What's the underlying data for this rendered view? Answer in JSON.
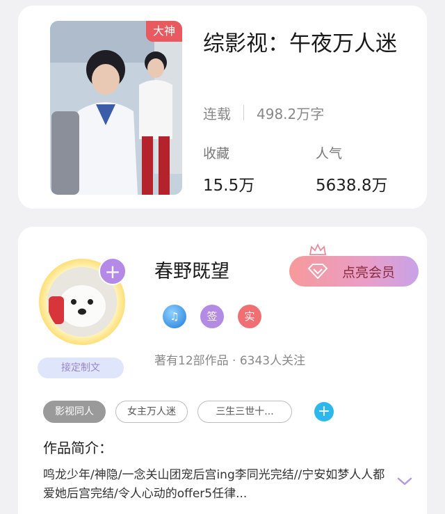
{
  "book": {
    "cover_badge": "大神",
    "title": "综影视：午夜万人迷",
    "status": "连载",
    "word_count": "498.2万字",
    "favorites_label": "收藏",
    "favorites_value": "15.5万",
    "popularity_label": "人气",
    "popularity_value": "5638.8万"
  },
  "author": {
    "name": "春野既望",
    "commission_tag": "接定制文",
    "vip_button_label": "点亮会员",
    "badges": [
      "music-badge",
      "签",
      "实"
    ],
    "meta": "著有12部作品 · 6343人关注",
    "tags": [
      "影视同人",
      "女主万人迷",
      "三生三世十..."
    ],
    "intro_heading": "作品简介：",
    "intro_text": "鸣龙少年/神隐/一念关山团宠后宫ing李同光完结//宁安如梦人人都爱她后宫完结/令人心动的offer5任律..."
  },
  "colors": {
    "badge_red": "#e85a5f",
    "plus_purple": "#b48ae6",
    "add_blue": "#2cb8ec",
    "vip_gradient_start": "#f69a9a",
    "vip_gradient_end": "#c8a2e8"
  }
}
